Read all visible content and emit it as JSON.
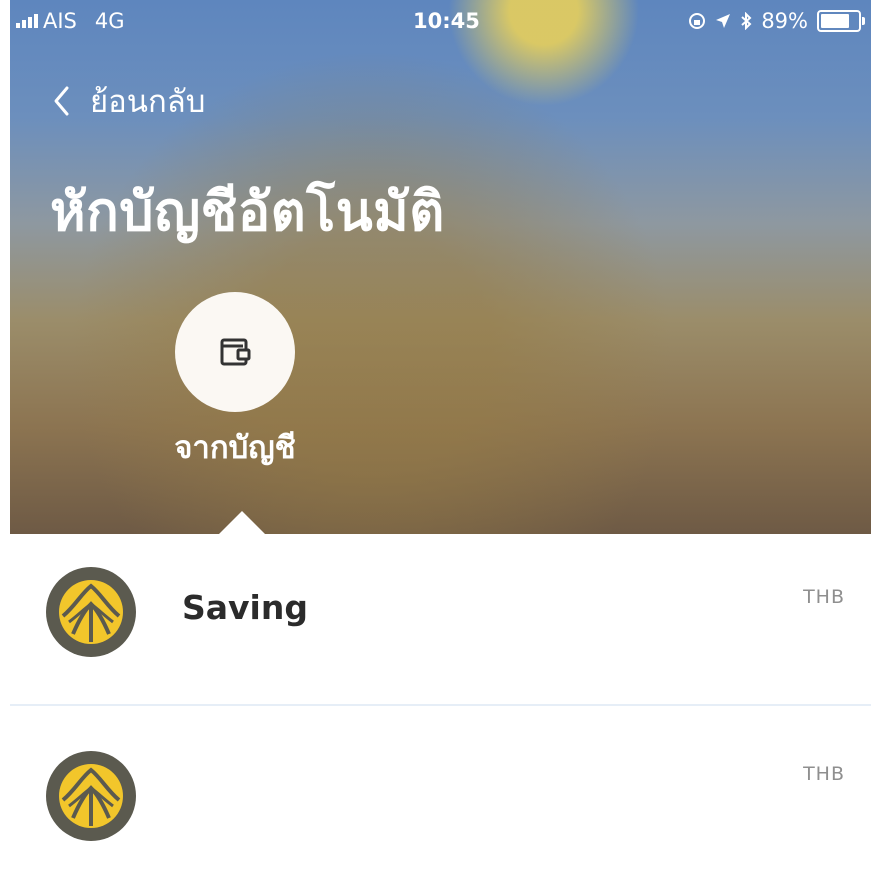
{
  "status_bar": {
    "carrier": "AIS",
    "network": "4G",
    "time": "10:45",
    "battery": "89%",
    "battery_level": 0.89,
    "icons": [
      "signal-icon",
      "location-icon",
      "bluetooth-icon",
      "battery-icon",
      "rotation-lock-icon"
    ]
  },
  "nav": {
    "back_label": "ย้อนกลับ"
  },
  "page": {
    "title": "หักบัญชีอัตโนมัติ"
  },
  "from_account": {
    "label": "จากบัญชี",
    "icon": "wallet-icon"
  },
  "accounts": [
    {
      "name": "Saving",
      "currency": "THB",
      "icon": "krungsri-logo-icon"
    },
    {
      "name": "",
      "currency": "THB",
      "icon": "krungsri-logo-icon"
    }
  ],
  "colors": {
    "logo_ring": "#5b5a4f",
    "logo_gold": "#f2c62b",
    "divider": "#e6eef7"
  }
}
